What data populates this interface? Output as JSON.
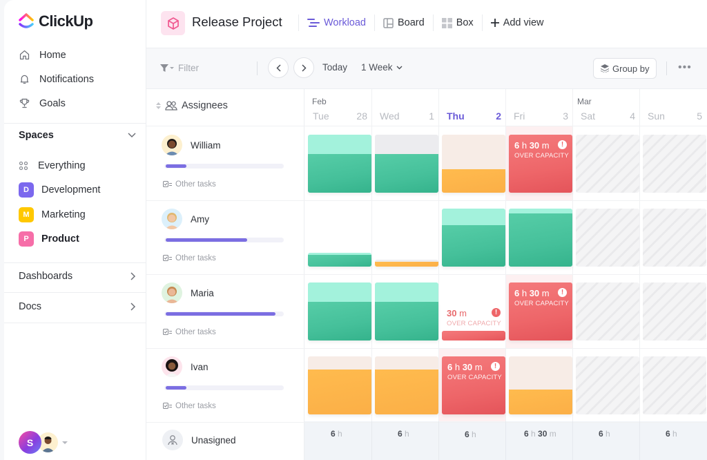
{
  "app": {
    "name": "ClickUp"
  },
  "sidebar": {
    "nav": [
      {
        "label": "Home",
        "icon": "home-icon"
      },
      {
        "label": "Notifications",
        "icon": "bell-icon"
      },
      {
        "label": "Goals",
        "icon": "trophy-icon"
      }
    ],
    "spaces_label": "Spaces",
    "everything_label": "Everything",
    "spaces": [
      {
        "letter": "D",
        "label": "Development",
        "color": "#7b68ee",
        "active": false
      },
      {
        "letter": "M",
        "label": "Marketing",
        "color": "#ffc800",
        "active": false
      },
      {
        "letter": "P",
        "label": "Product",
        "color": "#f66ea8",
        "active": true
      }
    ],
    "dashboards_label": "Dashboards",
    "docs_label": "Docs",
    "user_initial": "S"
  },
  "header": {
    "project_title": "Release Project",
    "views": [
      {
        "label": "Workload",
        "icon": "workload-icon",
        "active": true
      },
      {
        "label": "Board",
        "icon": "board-icon",
        "active": false
      },
      {
        "label": "Box",
        "icon": "box-icon",
        "active": false
      }
    ],
    "add_view_label": "Add view"
  },
  "toolbar": {
    "filter_placeholder": "Filter",
    "today_label": "Today",
    "range_label": "1 Week",
    "group_by_label": "Group by"
  },
  "grid": {
    "assignees_label": "Assignees",
    "months": [
      {
        "label": "Feb"
      },
      {
        "label": "Mar"
      }
    ],
    "days": [
      {
        "dow": "Tue",
        "num": "28",
        "today": false
      },
      {
        "dow": "Wed",
        "num": "1",
        "today": false
      },
      {
        "dow": "Thu",
        "num": "2",
        "today": true
      },
      {
        "dow": "Fri",
        "num": "3",
        "today": false
      },
      {
        "dow": "Sat",
        "num": "4",
        "today": false
      },
      {
        "dow": "Sun",
        "num": "5",
        "today": false
      }
    ],
    "other_tasks_label": "Other tasks",
    "over_capacity_label": "OVER CAPACITY",
    "people": [
      {
        "name": "William",
        "progress": 0.18,
        "cells": [
          {
            "type": "green",
            "fill": 0.67
          },
          {
            "type": "green-gray",
            "fill": 0.67
          },
          {
            "type": "orange",
            "fill": 0.4
          },
          {
            "type": "over",
            "hours": "6",
            "mins": "30"
          },
          {
            "type": "off"
          },
          {
            "type": "off"
          }
        ]
      },
      {
        "name": "Amy",
        "progress": 0.7,
        "cells": [
          {
            "type": "green",
            "fill": 0.2
          },
          {
            "type": "orange-gray",
            "fill": 0.08
          },
          {
            "type": "green",
            "fill": 0.72
          },
          {
            "type": "green",
            "fill": 0.92
          },
          {
            "type": "off"
          },
          {
            "type": "off"
          }
        ]
      },
      {
        "name": "Maria",
        "progress": 0.94,
        "cells": [
          {
            "type": "green",
            "fill": 0.67
          },
          {
            "type": "green",
            "fill": 0.67
          },
          {
            "type": "over-small",
            "hours": "",
            "mins": "30"
          },
          {
            "type": "over",
            "hours": "6",
            "mins": "30"
          },
          {
            "type": "off"
          },
          {
            "type": "off"
          }
        ]
      },
      {
        "name": "Ivan",
        "progress": 0.18,
        "cells": [
          {
            "type": "orange",
            "fill": 0.77
          },
          {
            "type": "orange",
            "fill": 0.77
          },
          {
            "type": "over",
            "hours": "6",
            "mins": "30"
          },
          {
            "type": "orange",
            "fill": 0.43
          },
          {
            "type": "off"
          },
          {
            "type": "off"
          }
        ]
      }
    ],
    "unassigned_label": "Unasigned",
    "totals": [
      {
        "h": "6",
        "m": ""
      },
      {
        "h": "6",
        "m": ""
      },
      {
        "h": "6",
        "m": ""
      },
      {
        "h": "6",
        "m": "30"
      },
      {
        "h": "6",
        "m": ""
      },
      {
        "h": "6",
        "m": ""
      }
    ],
    "hour_unit": "h",
    "minute_unit": "m"
  }
}
